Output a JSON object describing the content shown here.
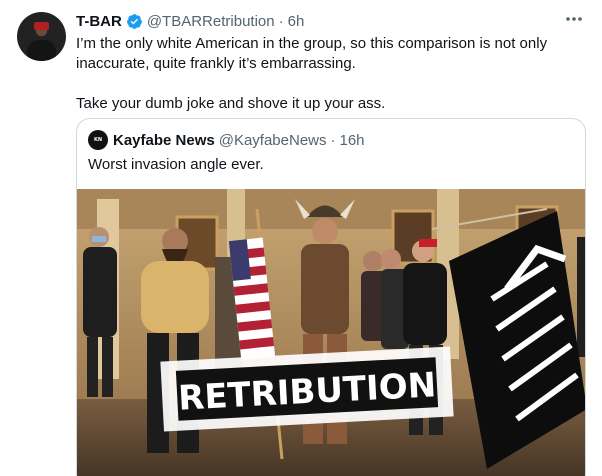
{
  "tweet": {
    "author_name": "T-BAR",
    "author_handle": "@TBARRetribution",
    "separator": "·",
    "time": "6h",
    "more_icon": "more-horizontal-icon",
    "verified_icon": "verified-badge-icon",
    "text_lines": [
      "I’m the only white American in the group, so this comparison is not only inaccurate, quite frankly it’s embarrassing.",
      "Take your dumb joke and shove it up your ass."
    ]
  },
  "quoted_tweet": {
    "author_name": "Kayfabe News",
    "author_handle": "@KayfabeNews",
    "separator": "·",
    "time": "16h",
    "text": "Worst invasion angle ever.",
    "media": {
      "overlay_text": "RETRIBUTION"
    }
  },
  "colors": {
    "verified": "#1d9bf0",
    "secondary_text": "#536471",
    "border": "#cfd9de"
  }
}
